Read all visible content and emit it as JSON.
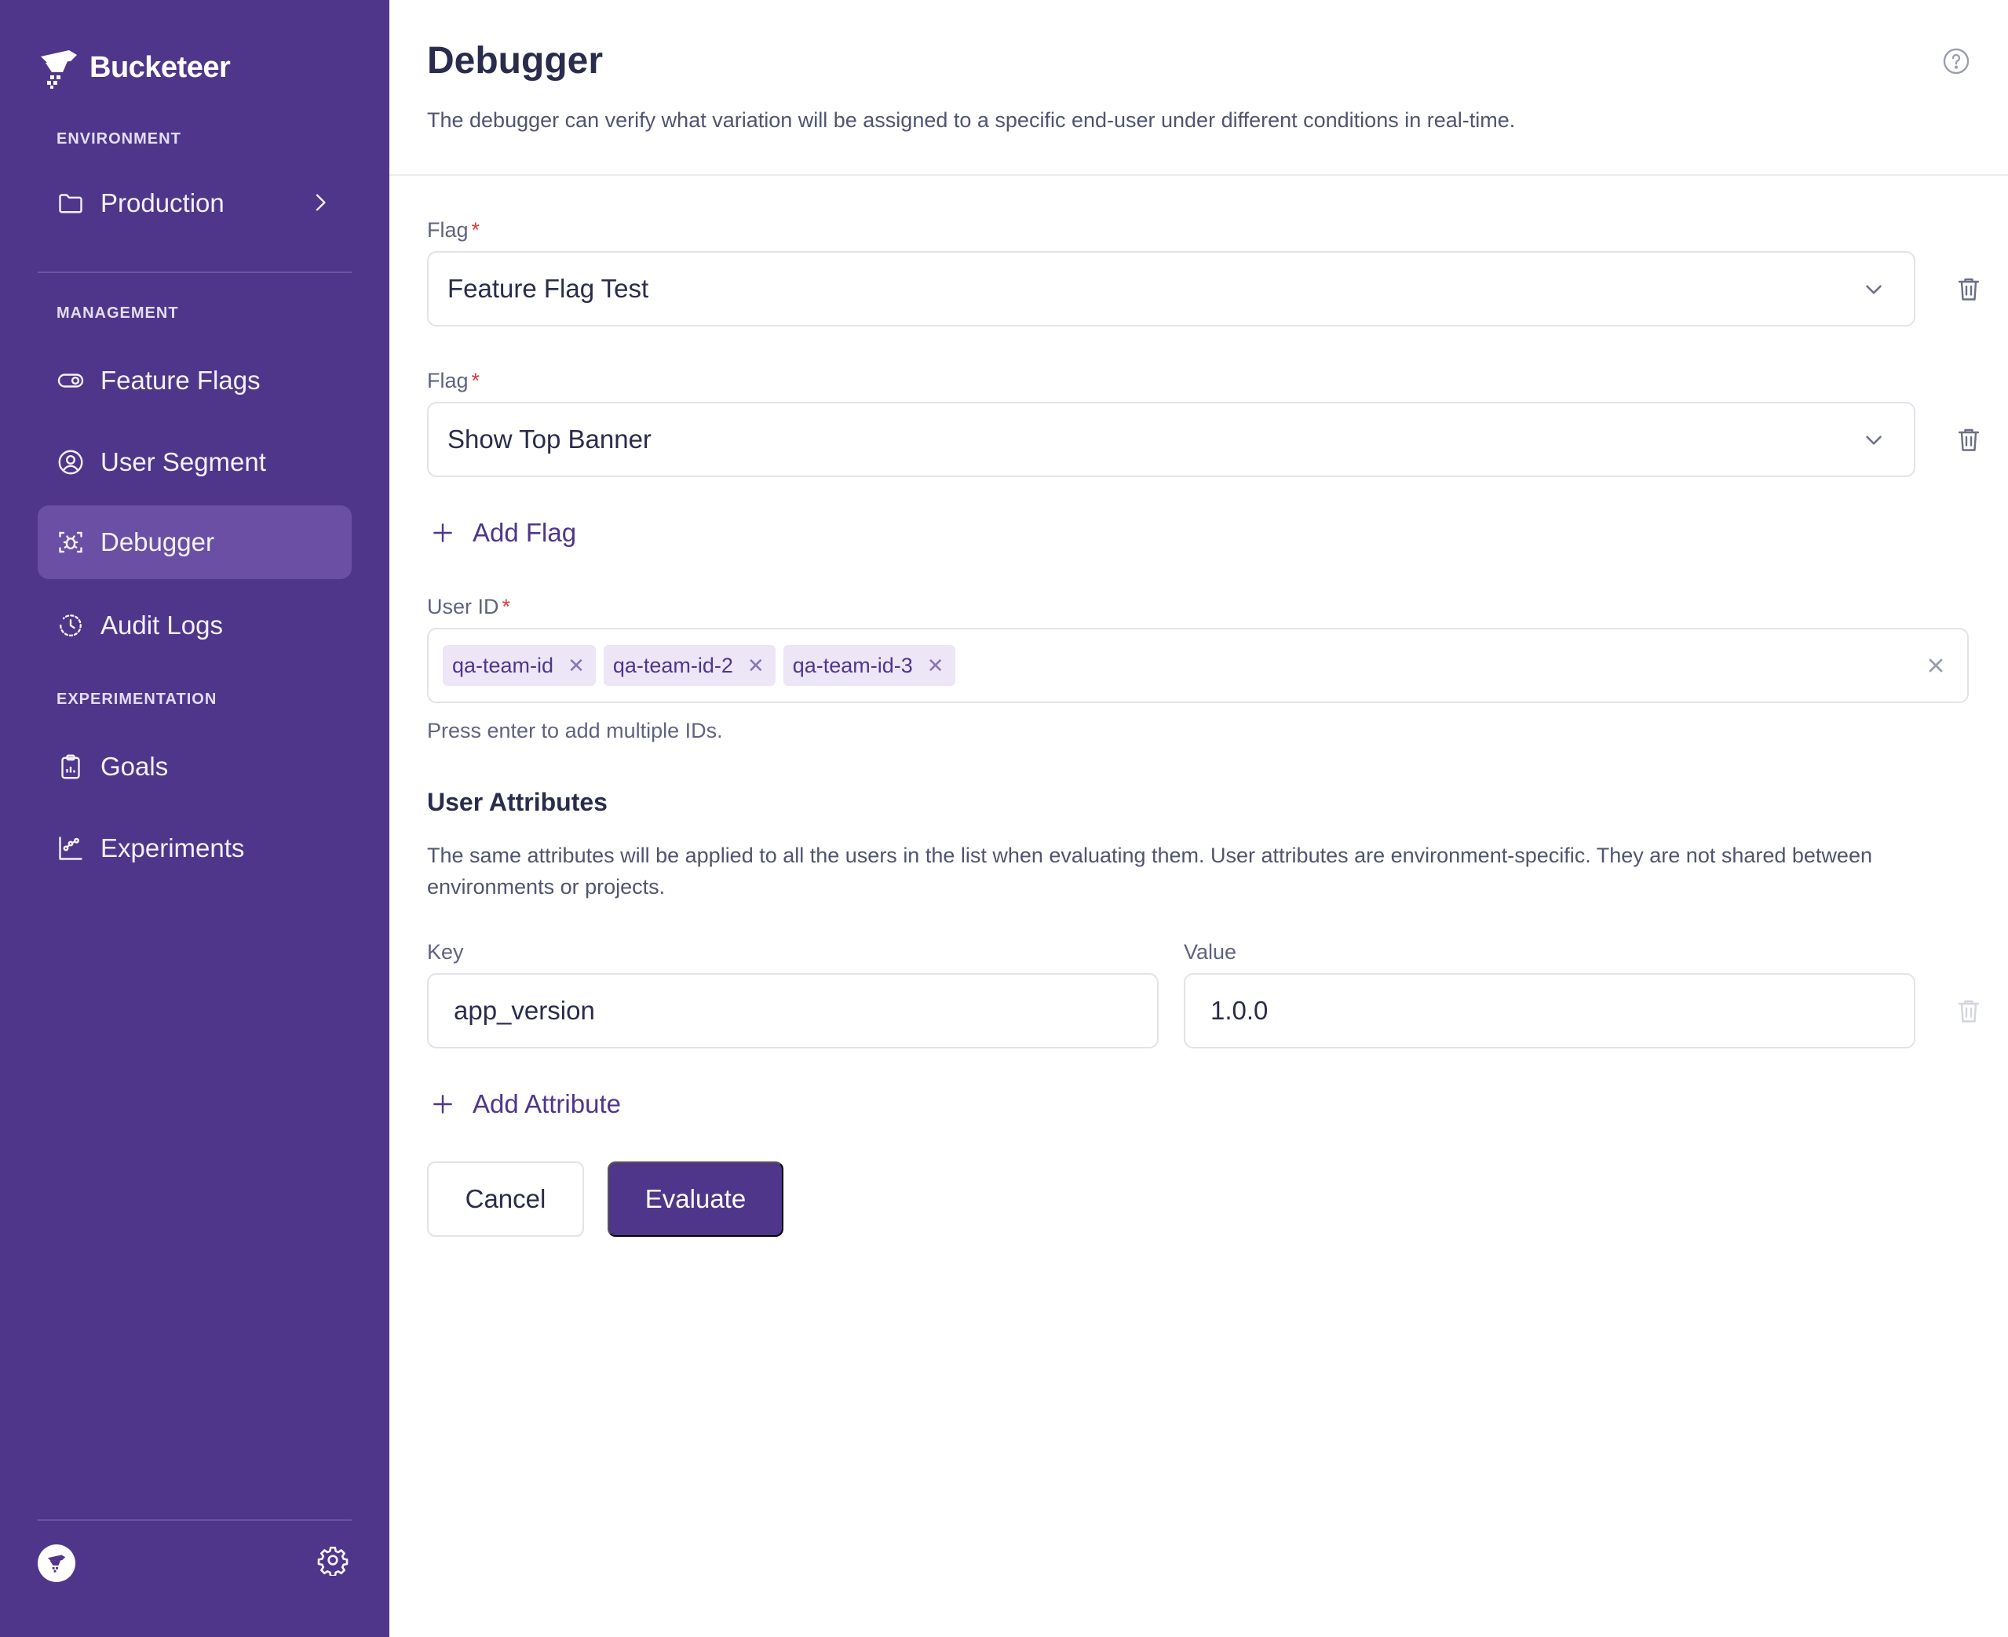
{
  "app": {
    "brand_name": "Bucketeer"
  },
  "sidebar": {
    "environment_label": "ENVIRONMENT",
    "environment_value": "Production",
    "management_label": "MANAGEMENT",
    "management_items": [
      {
        "label": "Feature Flags",
        "icon": "toggle-icon"
      },
      {
        "label": "User Segment",
        "icon": "user-circle-icon"
      },
      {
        "label": "Debugger",
        "icon": "bug-icon",
        "active": true
      },
      {
        "label": "Audit Logs",
        "icon": "history-icon"
      }
    ],
    "experimentation_label": "EXPERIMENTATION",
    "experimentation_items": [
      {
        "label": "Goals",
        "icon": "clipboard-icon"
      },
      {
        "label": "Experiments",
        "icon": "chart-icon"
      }
    ]
  },
  "page": {
    "title": "Debugger",
    "description": "The debugger can verify what variation will be assigned to a specific end-user under different conditions in real-time."
  },
  "form": {
    "flags": [
      {
        "label": "Flag",
        "value": "Feature Flag Test"
      },
      {
        "label": "Flag",
        "value": "Show Top Banner"
      }
    ],
    "required_mark": "*",
    "add_flag_label": "Add Flag",
    "user_id_label": "User ID",
    "user_ids": [
      "qa-team-id",
      "qa-team-id-2",
      "qa-team-id-3"
    ],
    "user_id_hint": "Press enter to add multiple IDs.",
    "attributes_title": "User Attributes",
    "attributes_description": "The same attributes will be applied to all the users in the list when evaluating them. User attributes are environment-specific. They are not shared between environments or projects.",
    "key_label": "Key",
    "value_label": "Value",
    "attribute_key": "app_version",
    "attribute_value": "1.0.0",
    "add_attribute_label": "Add Attribute",
    "cancel_label": "Cancel",
    "evaluate_label": "Evaluate"
  },
  "colors": {
    "sidebar_bg": "#4f368b",
    "sidebar_active": "#6a4fa4",
    "primary": "#4f368b",
    "required": "#e03b3b",
    "tag_bg": "#ece6f6"
  }
}
